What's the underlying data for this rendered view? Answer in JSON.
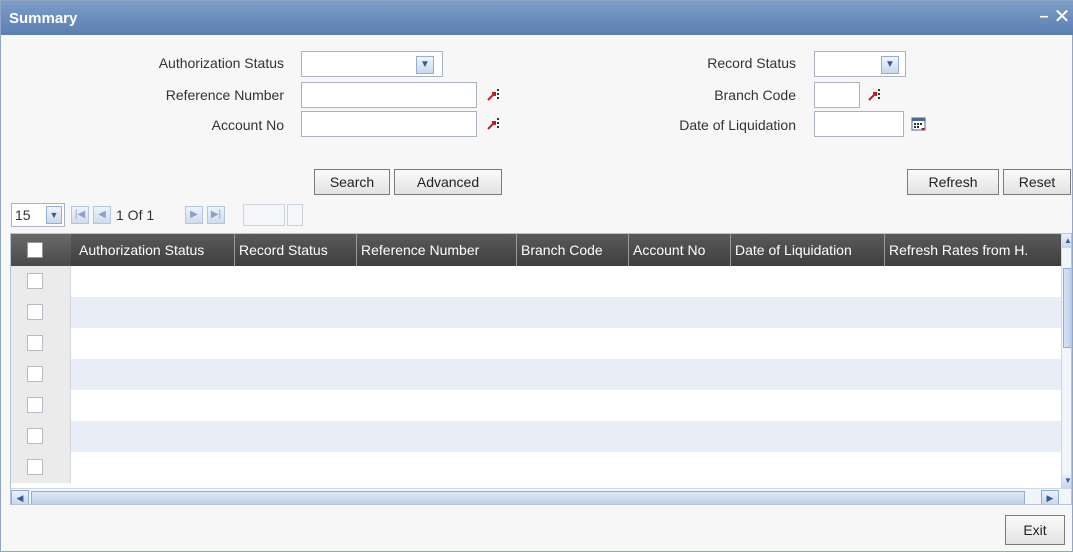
{
  "window": {
    "title": "Summary",
    "minimize": "–",
    "close": "✕"
  },
  "criteria": {
    "authorization_status": {
      "label": "Authorization Status",
      "value": ""
    },
    "reference_number": {
      "label": "Reference Number",
      "value": ""
    },
    "account_no": {
      "label": "Account No",
      "value": ""
    },
    "record_status": {
      "label": "Record Status",
      "value": ""
    },
    "branch_code": {
      "label": "Branch Code",
      "value": ""
    },
    "date_of_liquidation": {
      "label": "Date of Liquidation",
      "value": ""
    }
  },
  "buttons": {
    "search": "Search",
    "advanced": "Advanced",
    "refresh": "Refresh",
    "reset": "Reset",
    "exit": "Exit"
  },
  "pager": {
    "page_size": "15",
    "page_info": "1 Of 1"
  },
  "grid": {
    "columns": [
      "Authorization Status",
      "Record Status",
      "Reference Number",
      "Branch Code",
      "Account No",
      "Date of Liquidation",
      "Refresh Rates from H."
    ],
    "row_count": 7
  },
  "icons": {
    "select_arrow": "chevron-down-icon",
    "lov": "list-of-values-icon",
    "calendar": "calendar-icon",
    "first": "first-page-icon",
    "prev": "prev-page-icon",
    "next": "next-page-icon",
    "last": "last-page-icon"
  },
  "colors": {
    "titlebar": "#5b7fb0",
    "header": "#4a4a4a",
    "row_alt": "#e8eef7"
  }
}
